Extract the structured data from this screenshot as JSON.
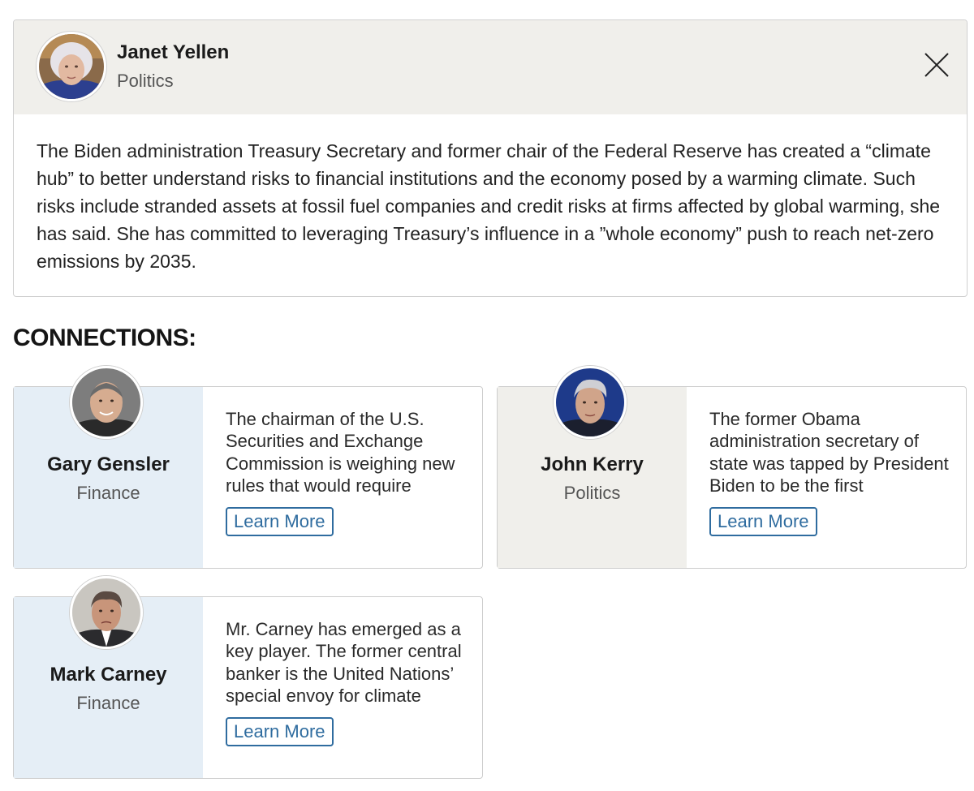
{
  "profile": {
    "name": "Janet Yellen",
    "category": "Politics",
    "description": "The Biden administration Treasury Secretary and former chair of the Federal Reserve has created a “climate hub” to better understand risks to financial institutions and the economy posed by a warming climate. Such risks include stranded assets at fossil fuel companies and credit risks at firms affected by global warming, she has said. She has committed to leveraging Treasury’s influence in a ”whole economy” push to reach net-zero emissions by 2035.",
    "close_icon": "close-icon"
  },
  "connections": {
    "heading": "CONNECTIONS:",
    "items": [
      {
        "name": "Gary Gensler",
        "category": "Finance",
        "description": "The chairman of the U.S. Securities and Exchange Commission is weighing new rules that would require",
        "button": "Learn More"
      },
      {
        "name": "John Kerry",
        "category": "Politics",
        "description": "The former Obama administration secretary of state was tapped by President Biden to be the first",
        "button": "Learn More"
      },
      {
        "name": "Mark Carney",
        "category": "Finance",
        "description": "Mr. Carney has emerged as a key player. The former central banker is the United Nations’ special envoy for climate",
        "button": "Learn More"
      }
    ]
  },
  "colors": {
    "finance_panel": "#e5eef6",
    "politics_panel": "#f0efeb",
    "link_blue": "#2f6c9f"
  }
}
